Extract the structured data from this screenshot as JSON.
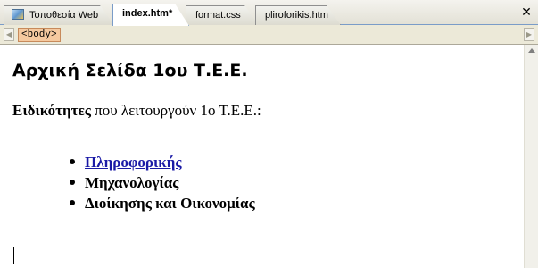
{
  "tabs": [
    {
      "label": "Τοποθεσία Web",
      "active": false
    },
    {
      "label": "index.htm*",
      "active": true
    },
    {
      "label": "format.css",
      "active": false
    },
    {
      "label": "pliroforikis.htm",
      "active": false
    }
  ],
  "close_label": "✕",
  "tag_selector": {
    "tag": "<body>"
  },
  "document": {
    "heading": "Αρχική Σελίδα 1ου Τ.Ε.Ε.",
    "intro_bold": "Ειδικότητες",
    "intro_rest": " που λειτουργούν 1ο Τ.Ε.Ε.:",
    "specialties": [
      {
        "label": "Πληροφορικής",
        "link": true
      },
      {
        "label": "Μηχανολογίας",
        "link": false
      },
      {
        "label": "Διοίκησης και Οικονομίας",
        "link": false
      }
    ]
  },
  "colors": {
    "link": "#1a1aa6",
    "tab_border": "#7a9cc8",
    "tag_pill": "#f5c99f"
  }
}
